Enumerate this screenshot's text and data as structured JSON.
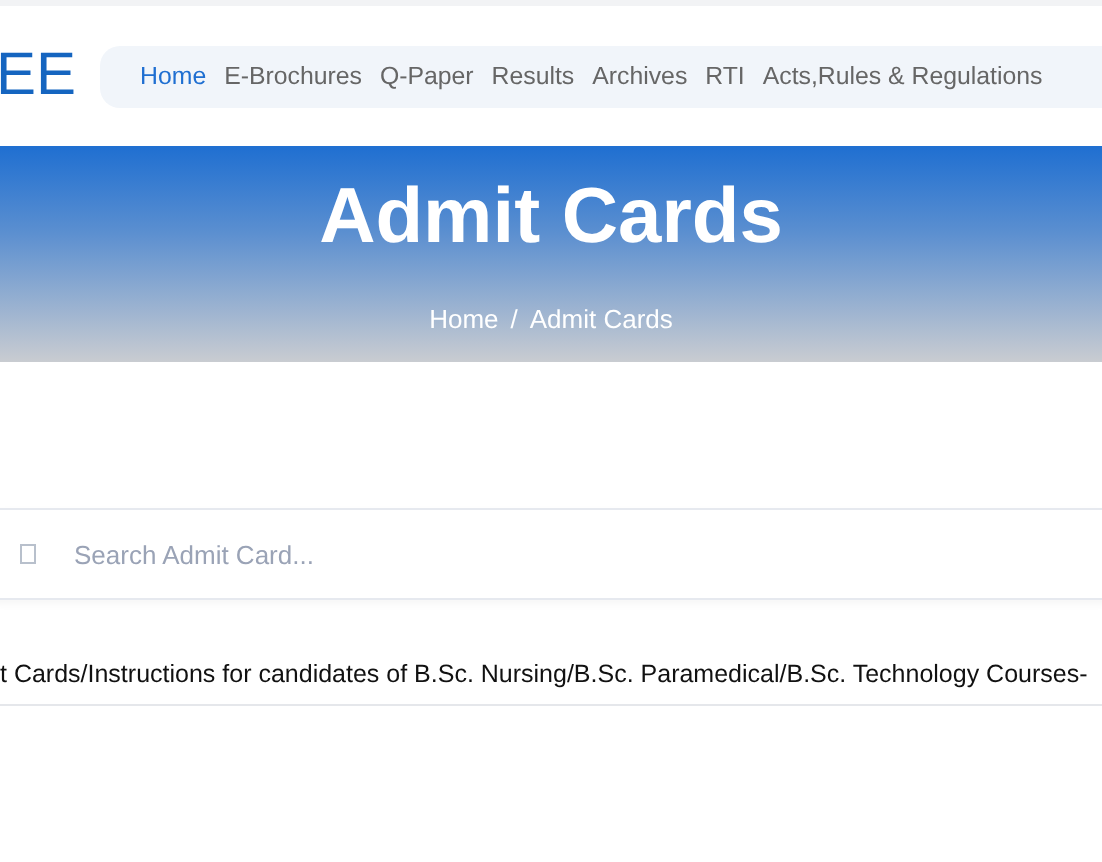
{
  "header": {
    "logo": "EE",
    "nav": [
      {
        "label": "Home",
        "selected": true
      },
      {
        "label": "E-Brochures",
        "selected": false
      },
      {
        "label": "Q-Paper",
        "selected": false
      },
      {
        "label": "Results",
        "selected": false
      },
      {
        "label": "Archives",
        "selected": false
      },
      {
        "label": "RTI",
        "selected": false
      },
      {
        "label": "Acts,Rules & Regulations",
        "selected": false
      }
    ]
  },
  "banner": {
    "title": "Admit Cards",
    "breadcrumb": [
      {
        "label": "Home"
      },
      {
        "label": "Admit Cards"
      }
    ],
    "separator": "/"
  },
  "search": {
    "placeholder": "Search Admit Card..."
  },
  "items": [
    "t Cards/Instructions for candidates of B.Sc. Nursing/B.Sc. Paramedical/B.Sc. Technology Courses-"
  ]
}
